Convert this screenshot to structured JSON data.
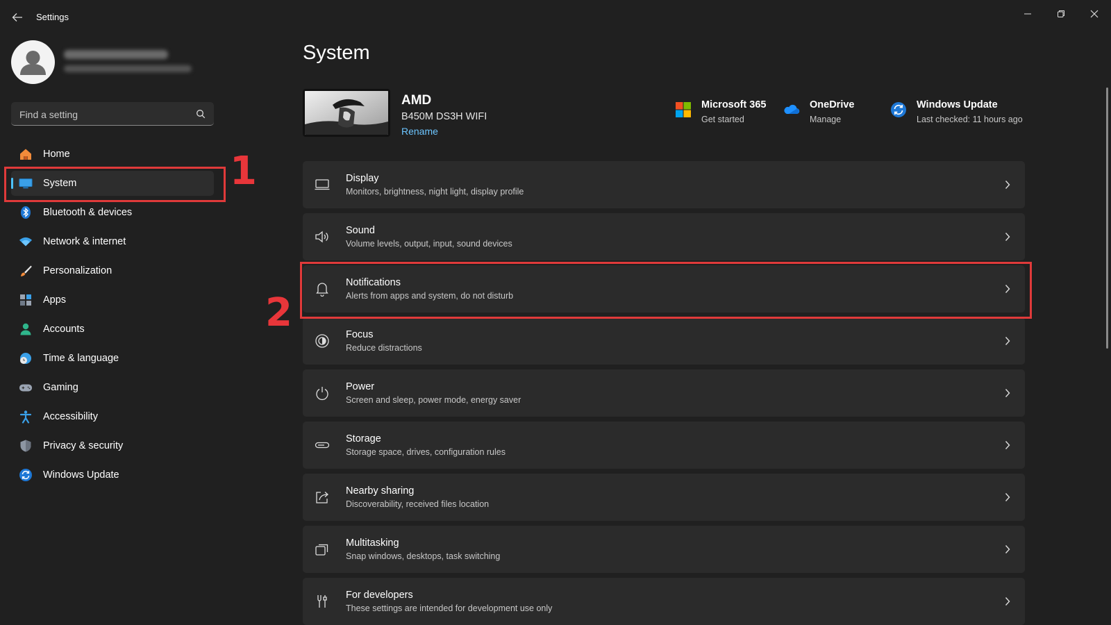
{
  "window": {
    "title": "Settings",
    "back_icon": "back-arrow-icon",
    "controls": [
      "minimize-icon",
      "maximize-icon",
      "close-icon"
    ]
  },
  "sidebar": {
    "search": {
      "placeholder": "Find a setting",
      "icon": "search-icon"
    },
    "items": [
      {
        "label": "Home",
        "icon": "home-icon",
        "active": false
      },
      {
        "label": "System",
        "icon": "system-icon",
        "active": true
      },
      {
        "label": "Bluetooth & devices",
        "icon": "bluetooth-icon",
        "active": false
      },
      {
        "label": "Network & internet",
        "icon": "wifi-icon",
        "active": false
      },
      {
        "label": "Personalization",
        "icon": "brush-icon",
        "active": false
      },
      {
        "label": "Apps",
        "icon": "apps-icon",
        "active": false
      },
      {
        "label": "Accounts",
        "icon": "person-icon",
        "active": false
      },
      {
        "label": "Time & language",
        "icon": "globe-clock-icon",
        "active": false
      },
      {
        "label": "Gaming",
        "icon": "gamepad-icon",
        "active": false
      },
      {
        "label": "Accessibility",
        "icon": "accessibility-icon",
        "active": false
      },
      {
        "label": "Privacy & security",
        "icon": "shield-icon",
        "active": false
      },
      {
        "label": "Windows Update",
        "icon": "update-icon",
        "active": false
      }
    ]
  },
  "main": {
    "title": "System",
    "device": {
      "name": "AMD",
      "model": "B450M DS3H WIFI",
      "rename_label": "Rename"
    },
    "quick_links": [
      {
        "title": "Microsoft 365",
        "subtitle": "Get started",
        "icon": "microsoft-logo-icon"
      },
      {
        "title": "OneDrive",
        "subtitle": "Manage",
        "icon": "onedrive-cloud-icon"
      },
      {
        "title": "Windows Update",
        "subtitle": "Last checked: 11 hours ago",
        "icon": "windows-update-icon"
      }
    ],
    "settings": [
      {
        "title": "Display",
        "subtitle": "Monitors, brightness, night light, display profile",
        "icon": "monitor-icon"
      },
      {
        "title": "Sound",
        "subtitle": "Volume levels, output, input, sound devices",
        "icon": "speaker-icon"
      },
      {
        "title": "Notifications",
        "subtitle": "Alerts from apps and system, do not disturb",
        "icon": "bell-icon"
      },
      {
        "title": "Focus",
        "subtitle": "Reduce distractions",
        "icon": "focus-icon"
      },
      {
        "title": "Power",
        "subtitle": "Screen and sleep, power mode, energy saver",
        "icon": "power-icon"
      },
      {
        "title": "Storage",
        "subtitle": "Storage space, drives, configuration rules",
        "icon": "storage-icon"
      },
      {
        "title": "Nearby sharing",
        "subtitle": "Discoverability, received files location",
        "icon": "share-icon"
      },
      {
        "title": "Multitasking",
        "subtitle": "Snap windows, desktops, task switching",
        "icon": "multitasking-icon"
      },
      {
        "title": "For developers",
        "subtitle": "These settings are intended for development use only",
        "icon": "developer-tools-icon"
      }
    ]
  },
  "annotations": {
    "step_1": "1",
    "step_2": "2"
  },
  "colors": {
    "background": "#202020",
    "card": "#2b2b2b",
    "accent": "#4cc2ff",
    "highlight": "#e03a3a"
  }
}
